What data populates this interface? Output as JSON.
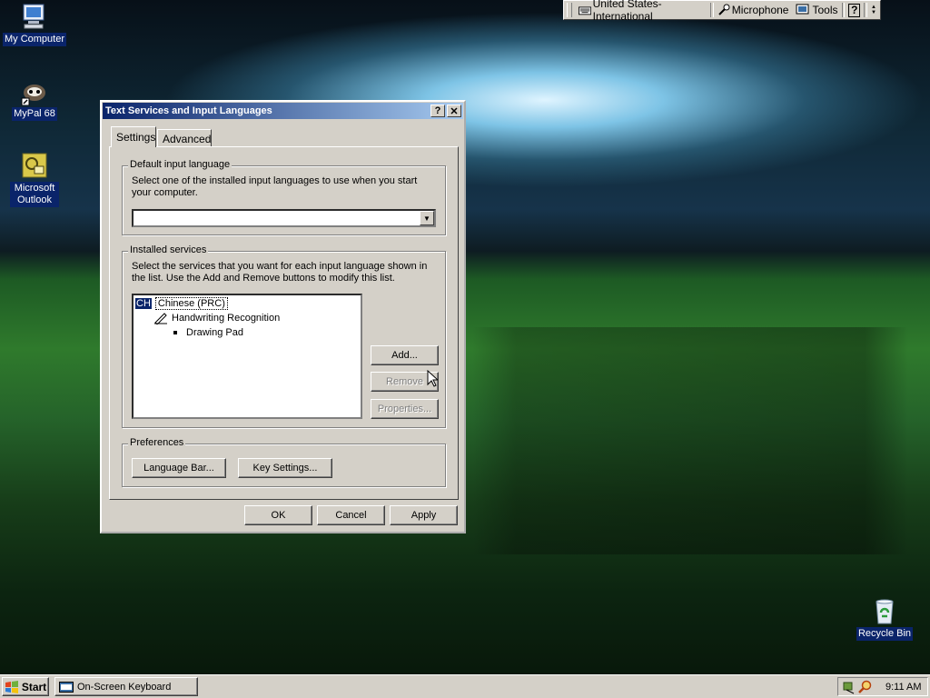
{
  "desktop": {
    "icons": [
      {
        "label": "My Computer",
        "icon": "my-computer-icon"
      },
      {
        "label": "MyPal 68",
        "icon": "mypal-icon"
      },
      {
        "label": "Microsoft Outlook",
        "icon": "outlook-icon"
      },
      {
        "label": "Recycle Bin",
        "icon": "recycle-bin-icon"
      }
    ]
  },
  "language_bar": {
    "language": "United States-International",
    "microphone": "Microphone",
    "tools": "Tools",
    "help": "?"
  },
  "dialog": {
    "title": "Text Services and Input Languages",
    "title_help": "?",
    "title_close": "✕",
    "tabs": [
      "Settings",
      "Advanced"
    ],
    "default_language": {
      "title": "Default input language",
      "description": "Select one of the installed input languages to use when you start your computer.",
      "selected_value": ""
    },
    "installed_services": {
      "title": "Installed services",
      "description": "Select the services that you want for each input language shown in the list. Use the Add and Remove buttons to modify this list.",
      "tree": {
        "language_code": "CH",
        "language": "Chinese (PRC)",
        "service": "Handwriting Recognition",
        "sub_service": "Drawing Pad"
      },
      "add_label": "Add...",
      "remove_label": "Remove",
      "properties_label": "Properties..."
    },
    "preferences": {
      "title": "Preferences",
      "language_bar_label": "Language Bar...",
      "key_settings_label": "Key Settings..."
    },
    "ok_label": "OK",
    "cancel_label": "Cancel",
    "apply_label": "Apply"
  },
  "taskbar": {
    "start_label": "Start",
    "task_label": "On-Screen Keyboard",
    "clock": "9:11 AM"
  }
}
